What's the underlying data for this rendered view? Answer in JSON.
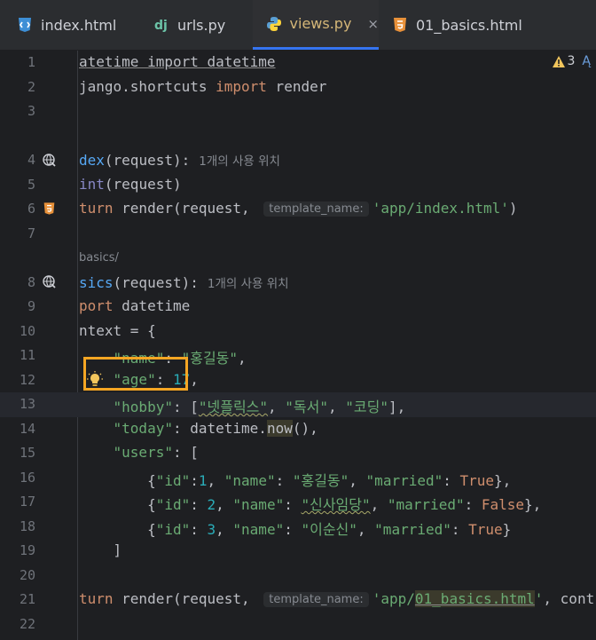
{
  "tabs": [
    {
      "label": "index.html",
      "icon": "html-file-icon",
      "active": false
    },
    {
      "label": "urls.py",
      "icon": "django-icon",
      "active": false
    },
    {
      "label": "views.py",
      "icon": "python-icon",
      "active": true
    },
    {
      "label": "01_basics.html",
      "icon": "html5-icon",
      "active": false
    }
  ],
  "close_symbol": "×",
  "warning": {
    "count": "3",
    "trailing": "Ą"
  },
  "line_numbers": [
    "1",
    "2",
    "3",
    "4",
    "5",
    "6",
    "7",
    "8",
    "9",
    "10",
    "11",
    "12",
    "13",
    "14",
    "15",
    "16",
    "17",
    "18",
    "19",
    "20",
    "21",
    "22"
  ],
  "code": {
    "l1": {
      "a": "atetime import datetime"
    },
    "l2": {
      "a": "jango.shortcuts ",
      "b": "import",
      "c": " render"
    },
    "l4": {
      "a": "dex",
      "b": "(request):",
      "usage": "1개의 사용 위치"
    },
    "l5": {
      "a": "int",
      "b": "(request)"
    },
    "l6": {
      "a": "turn",
      "b": " render(request, ",
      "hint": "template_name:",
      "c": "'app/index.html'",
      "d": ")"
    },
    "url_hint": "basics/",
    "l8": {
      "a": "sics",
      "b": "(request):",
      "usage": "1개의 사용 위치"
    },
    "l9": {
      "a": "port",
      "b": " datetime"
    },
    "l10": {
      "a": "ntext = {"
    },
    "l11": {
      "a": "    ",
      "b": "\"name\"",
      "c": ": ",
      "d": "\"홍길동\"",
      "e": ","
    },
    "l12": {
      "a": "    ",
      "b": "\"age\"",
      "c": ": ",
      "d": "17",
      "e": ","
    },
    "l13": {
      "a": "    ",
      "b": "\"hobby\"",
      "c": ": [",
      "d": "\"넷플릭스\"",
      "e": ", ",
      "f": "\"독서\"",
      "g": ", ",
      "h": "\"코딩\"",
      "i": "],"
    },
    "l14": {
      "a": "    ",
      "b": "\"today\"",
      "c": ": datetime.",
      "d": "now",
      "e": "(),"
    },
    "l15": {
      "a": "    ",
      "b": "\"users\"",
      "c": ": ["
    },
    "l16": {
      "a": "        {",
      "b": "\"id\"",
      "c": ":",
      "d": "1",
      "e": ", ",
      "f": "\"name\"",
      "g": ": ",
      "h": "\"홍길동\"",
      "i": ", ",
      "j": "\"married\"",
      "k": ": ",
      "l": "True",
      "m": "},"
    },
    "l17": {
      "a": "        {",
      "b": "\"id\"",
      "c": ": ",
      "d": "2",
      "e": ", ",
      "f": "\"name\"",
      "g": ": ",
      "h": "\"신사임당\"",
      "i": ", ",
      "j": "\"married\"",
      "k": ": ",
      "l": "False",
      "m": "},"
    },
    "l18": {
      "a": "        {",
      "b": "\"id\"",
      "c": ": ",
      "d": "3",
      "e": ", ",
      "f": "\"name\"",
      "g": ": ",
      "h": "\"이순신\"",
      "i": ", ",
      "j": "\"married\"",
      "k": ": ",
      "l": "True",
      "m": "}"
    },
    "l19": {
      "a": "    ]"
    },
    "l21": {
      "a": "turn",
      "b": " render(request, ",
      "hint": "template_name:",
      "c": "'app/",
      "d": "01_basics.html",
      "e": "'",
      "f": ", cont"
    }
  }
}
